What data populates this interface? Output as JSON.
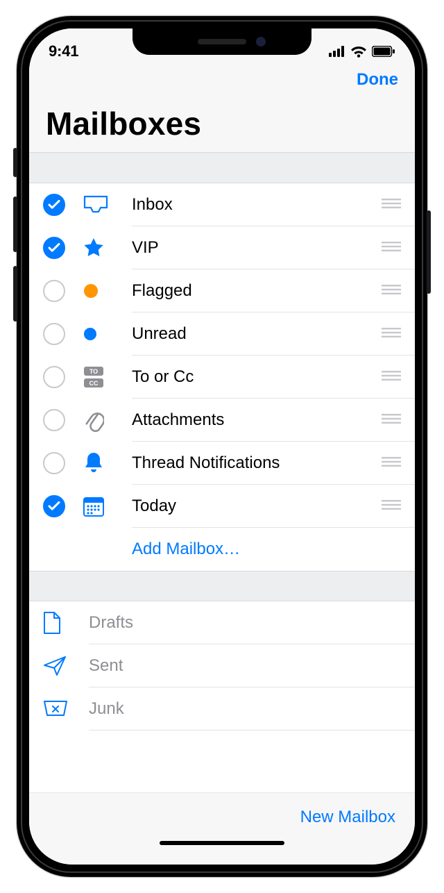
{
  "status": {
    "time": "9:41"
  },
  "nav": {
    "done": "Done"
  },
  "header": {
    "title": "Mailboxes"
  },
  "mailboxes": [
    {
      "label": "Inbox",
      "icon": "inbox",
      "checked": true
    },
    {
      "label": "VIP",
      "icon": "star",
      "checked": true
    },
    {
      "label": "Flagged",
      "icon": "flag-dot",
      "checked": false
    },
    {
      "label": "Unread",
      "icon": "unread-dot",
      "checked": false
    },
    {
      "label": "To or Cc",
      "icon": "to-cc",
      "checked": false
    },
    {
      "label": "Attachments",
      "icon": "clip",
      "checked": false
    },
    {
      "label": "Thread Notifications",
      "icon": "bell",
      "checked": false
    },
    {
      "label": "Today",
      "icon": "calendar",
      "checked": true
    }
  ],
  "add_mailbox": "Add Mailbox…",
  "secondary": [
    {
      "label": "Drafts",
      "icon": "document"
    },
    {
      "label": "Sent",
      "icon": "paperplane"
    },
    {
      "label": "Junk",
      "icon": "junkbox"
    }
  ],
  "toolbar": {
    "new_mailbox": "New Mailbox"
  }
}
